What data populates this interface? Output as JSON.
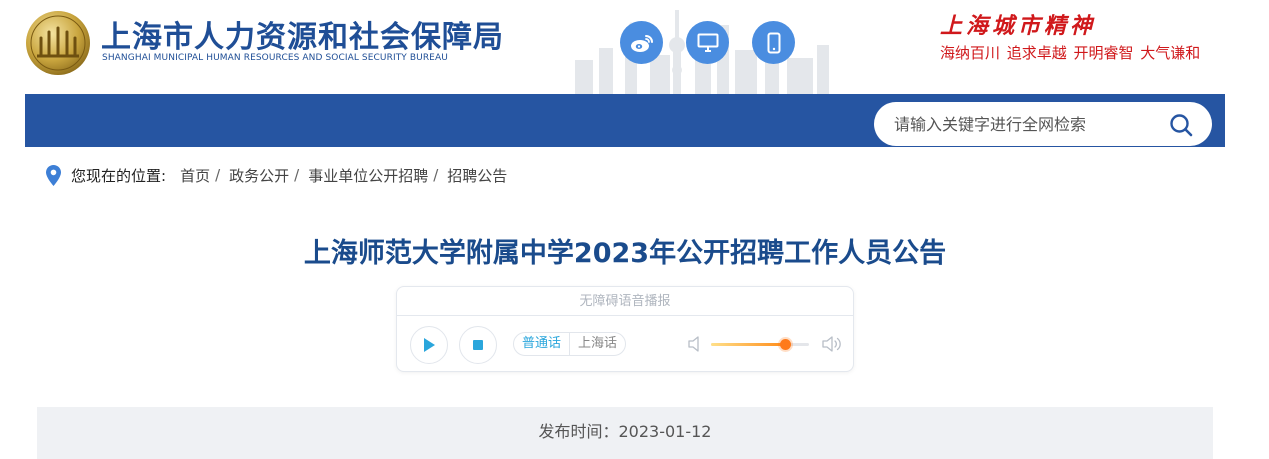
{
  "header": {
    "org_name_cn": "上海市人力资源和社会保障局",
    "org_name_en": "SHANGHAI MUNICIPAL HUMAN RESOURCES AND SOCIAL SECURITY BUREAU",
    "social_icons": [
      "weibo-icon",
      "desktop-icon",
      "mobile-icon"
    ],
    "spirit_title": "上海城市精神",
    "spirit_motto": "海纳百川  追求卓越  开明睿智  大气谦和"
  },
  "search": {
    "placeholder": "请输入关键字进行全网检索"
  },
  "breadcrumb": {
    "label": "您现在的位置:",
    "items": [
      "首页",
      "政务公开",
      "事业单位公开招聘",
      "招聘公告"
    ],
    "separator": "/"
  },
  "article": {
    "title": "上海师范大学附属中学2023年公开招聘工作人员公告",
    "publish_text": "发布时间：2023-01-12"
  },
  "player": {
    "header": "无障碍语音播报",
    "languages": [
      "普通话",
      "上海话"
    ],
    "active_language": "普通话",
    "volume": 0.76
  },
  "colors": {
    "brand_blue": "#2655a2",
    "title_blue": "#1a4b8c",
    "spirit_red": "#d0181b",
    "accent_cyan": "#2aa6dc",
    "volume_orange": "#ff7a1a"
  }
}
